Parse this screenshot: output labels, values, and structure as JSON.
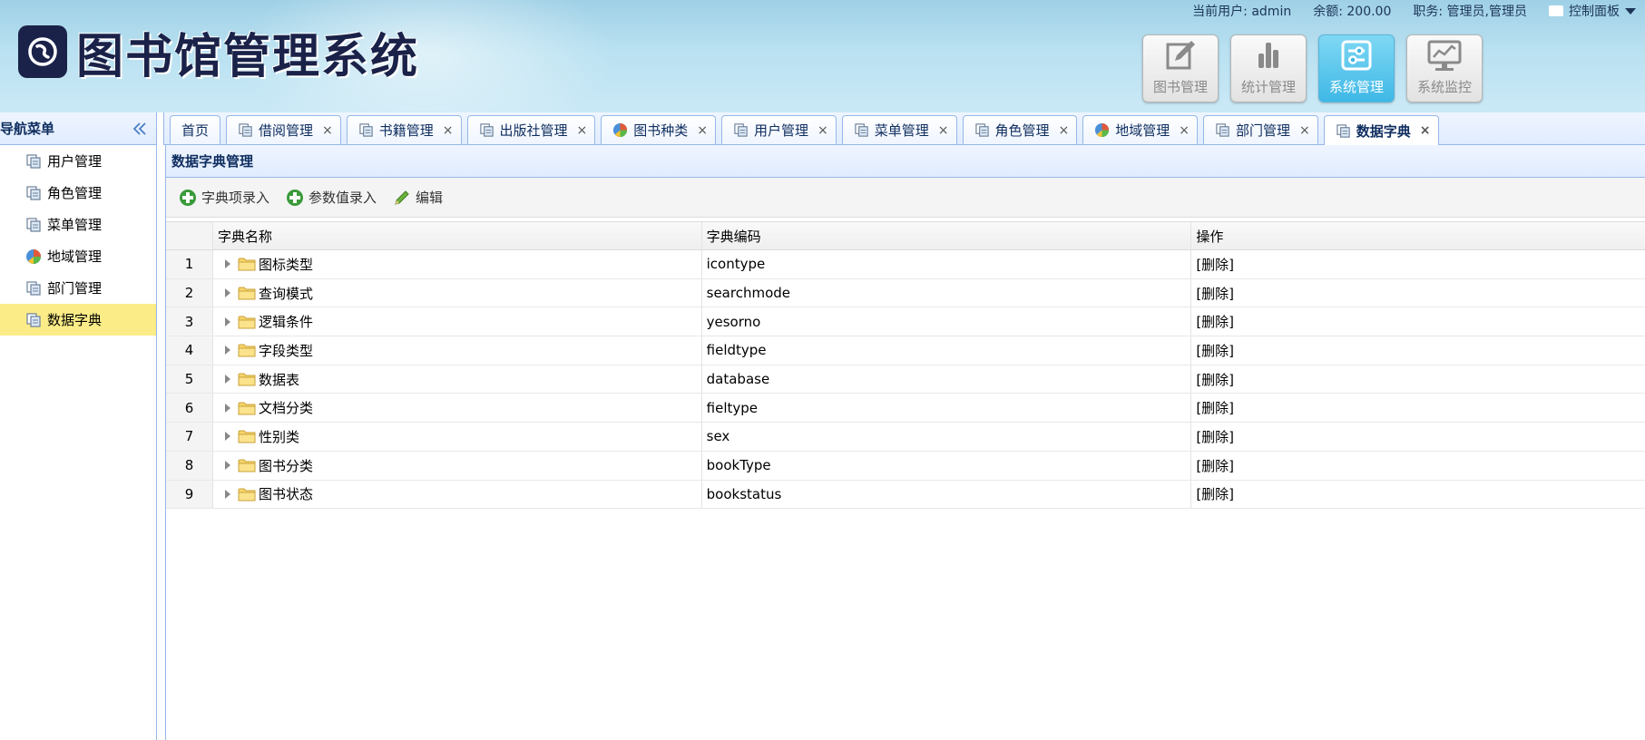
{
  "header": {
    "logo_text": "图书馆管理系统",
    "current_user_label": "当前用户: admin",
    "balance_label": "余额: 200.00",
    "role_label": "职务: 管理员,管理员",
    "control_panel_label": "控制面板"
  },
  "modules": [
    {
      "label": "图书管理",
      "icon": "edit-icon",
      "active": false
    },
    {
      "label": "统计管理",
      "icon": "bar-chart-icon",
      "active": false
    },
    {
      "label": "系统管理",
      "icon": "settings-icon",
      "active": true
    },
    {
      "label": "系统监控",
      "icon": "monitor-icon",
      "active": false
    }
  ],
  "nav": {
    "title": "导航菜单",
    "items": [
      {
        "label": "用户管理",
        "icon": "pages-icon",
        "selected": false
      },
      {
        "label": "角色管理",
        "icon": "pages-icon",
        "selected": false
      },
      {
        "label": "菜单管理",
        "icon": "pages-icon",
        "selected": false
      },
      {
        "label": "地域管理",
        "icon": "pie-icon",
        "selected": false
      },
      {
        "label": "部门管理",
        "icon": "pages-icon",
        "selected": false
      },
      {
        "label": "数据字典",
        "icon": "pages-icon",
        "selected": true
      }
    ]
  },
  "tabs": [
    {
      "label": "首页",
      "icon": "",
      "closable": false,
      "active": false
    },
    {
      "label": "借阅管理",
      "icon": "pages-icon",
      "closable": true,
      "active": false
    },
    {
      "label": "书籍管理",
      "icon": "pages-icon",
      "closable": true,
      "active": false
    },
    {
      "label": "出版社管理",
      "icon": "pages-icon",
      "closable": true,
      "active": false
    },
    {
      "label": "图书种类",
      "icon": "pie-icon",
      "closable": true,
      "active": false
    },
    {
      "label": "用户管理",
      "icon": "pages-icon",
      "closable": true,
      "active": false
    },
    {
      "label": "菜单管理",
      "icon": "pages-icon",
      "closable": true,
      "active": false
    },
    {
      "label": "角色管理",
      "icon": "pages-icon",
      "closable": true,
      "active": false
    },
    {
      "label": "地域管理",
      "icon": "pie-icon",
      "closable": true,
      "active": false
    },
    {
      "label": "部门管理",
      "icon": "pages-icon",
      "closable": true,
      "active": false
    },
    {
      "label": "数据字典",
      "icon": "pages-icon",
      "closable": true,
      "active": true
    }
  ],
  "tab_close_glyph": "×",
  "panel": {
    "title": "数据字典管理",
    "toolbar": {
      "add_item_label": "字典项录入",
      "add_param_label": "参数值录入",
      "edit_label": "编辑"
    }
  },
  "grid": {
    "columns": [
      "字典名称",
      "字典编码",
      "操作"
    ],
    "rows": [
      {
        "num": "1",
        "name": "图标类型",
        "code": "icontype",
        "op": "[删除]"
      },
      {
        "num": "2",
        "name": "查询模式",
        "code": "searchmode",
        "op": "[删除]"
      },
      {
        "num": "3",
        "name": "逻辑条件",
        "code": "yesorno",
        "op": "[删除]"
      },
      {
        "num": "4",
        "name": "字段类型",
        "code": "fieldtype",
        "op": "[删除]"
      },
      {
        "num": "5",
        "name": "数据表",
        "code": "database",
        "op": "[删除]"
      },
      {
        "num": "6",
        "name": "文档分类",
        "code": "fieltype",
        "op": "[删除]"
      },
      {
        "num": "7",
        "name": "性别类",
        "code": "sex",
        "op": "[删除]"
      },
      {
        "num": "8",
        "name": "图书分类",
        "code": "bookType",
        "op": "[删除]"
      },
      {
        "num": "9",
        "name": "图书状态",
        "code": "bookstatus",
        "op": "[删除]"
      }
    ]
  },
  "colors": {
    "accent_blue": "#95b8e7",
    "selected_yellow": "#fbec88",
    "module_active": "#3fb8e6",
    "title_navy": "#1a2249"
  }
}
